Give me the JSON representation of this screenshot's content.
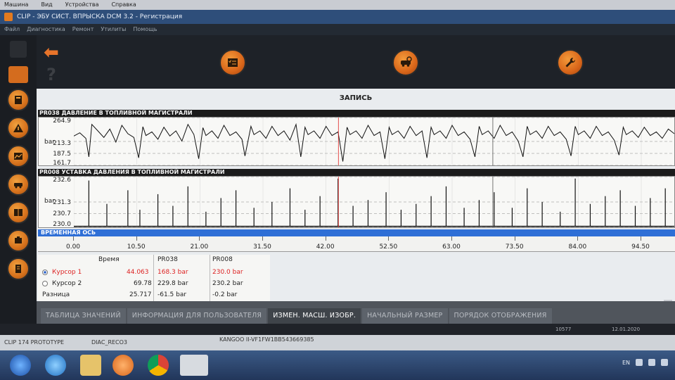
{
  "host_menu": [
    "Машина",
    "Вид",
    "Устройства",
    "Справка"
  ],
  "window_title": "CLIP - ЭБУ СИСТ. ВПРЫСКА DCM 3.2 - Регистрация",
  "app_menu": [
    "Файл",
    "Диагностика",
    "Ремонт",
    "Утилиты",
    "Помощь"
  ],
  "toolbar": {
    "icons": [
      "checklist-icon",
      "vehicle-diag-icon",
      "wrench-icon"
    ]
  },
  "left_rail": {
    "icons": [
      "home-icon",
      "printer-icon",
      "help-icon",
      "calculator-icon",
      "warning-icon",
      "chart-icon",
      "vehicle-icon",
      "book-icon",
      "engine-icon",
      "manual-icon"
    ]
  },
  "page": {
    "title": "ЗАПИСЬ"
  },
  "chart1": {
    "header": "PR038  ДАВЛЕНИЕ В ТОПЛИВНОЙ МАГИСТРАЛИ",
    "unit": "bar",
    "ticks": [
      "264.9",
      "213.3",
      "187.5",
      "161.7"
    ]
  },
  "chart2": {
    "header": "PR008  УСТАВКА ДАВЛЕНИЯ В ТОПЛИВНОЙ МАГИСТРАЛИ",
    "unit": "bar",
    "ticks": [
      "232.6",
      "231.3",
      "230.7",
      "230.0"
    ]
  },
  "time_axis": {
    "label": "ВРЕМЕННАЯ ОСЬ",
    "ticks": [
      "0.00",
      "10.50",
      "21.00",
      "31.50",
      "42.00",
      "52.50",
      "63.00",
      "73.50",
      "84.00",
      "94.50"
    ]
  },
  "cursor_table": {
    "headers": [
      "Время",
      "PR038",
      "PR008"
    ],
    "rows": [
      {
        "label": "Курсор 1",
        "time": "44.063",
        "pr038": "168.3 bar",
        "pr008": "230.0 bar"
      },
      {
        "label": "Курсор 2",
        "time": "69.78",
        "pr038": "229.8 bar",
        "pr008": "230.2 bar"
      },
      {
        "label": "Разница",
        "time": "25.717",
        "pr038": "-61.5 bar",
        "pr008": "-0.2 bar"
      }
    ]
  },
  "tabs": [
    "ТАБЛИЦА ЗНАЧЕНИЙ",
    "ИНФОРМАЦИЯ ДЛЯ ПОЛЬЗОВАТЕЛЯ",
    "ИЗМЕН. МАСШ. ИЗОБР.",
    "НАЧАЛЬНЫЙ РАЗМЕР",
    "ПОРЯДОК ОТОБРАЖЕНИЯ"
  ],
  "status": {
    "code": "10577",
    "date": "12.01.2020",
    "device": "CLIP 174 PROTOTYPE",
    "reco": "DIAC_RECO3",
    "vehicle": "KANGOO II-VF1FW1BB543669385"
  },
  "taskbar": {
    "apps": [
      "windows-start-icon",
      "ie-icon",
      "folder-icon",
      "media-player-icon",
      "chrome-icon",
      "clip-app-icon"
    ],
    "language": "EN"
  },
  "chart_data": [
    {
      "type": "line",
      "title": "PR038  ДАВЛЕНИЕ В ТОПЛИВНОЙ МАГИСТРАЛИ",
      "ylabel": "bar",
      "ylim": [
        161.7,
        264.9
      ],
      "y_ticks": [
        264.9,
        213.3,
        187.5,
        161.7
      ],
      "x_ticks": [
        0.0,
        10.5,
        21.0,
        31.5,
        42.0,
        52.5,
        63.0,
        73.5,
        84.0,
        94.5
      ],
      "xlim": [
        0,
        100
      ],
      "series": [
        {
          "x": [
            0,
            1,
            2,
            2.5,
            3,
            4,
            5,
            6,
            7,
            8,
            9,
            10,
            10.8,
            11.5,
            12,
            13,
            14,
            15,
            16,
            17,
            18,
            19,
            20,
            20.8,
            21.5,
            22,
            23,
            24,
            25,
            26,
            27,
            28,
            28.5,
            29.5,
            30,
            31,
            32,
            33,
            34,
            35,
            36,
            37,
            37.8,
            38.5,
            39,
            40,
            41,
            42,
            43,
            44,
            44.8,
            45.5,
            46,
            47,
            48,
            49,
            50,
            51,
            51.8,
            52.5,
            53,
            54,
            55,
            56,
            57,
            58,
            58.8,
            59.5,
            60,
            61,
            62,
            63,
            64,
            65,
            66,
            66.8,
            67.5,
            68,
            69,
            70,
            71,
            72,
            73,
            74,
            74.8,
            75.5,
            76,
            77,
            78,
            79,
            80,
            81,
            82,
            82.8,
            83.5,
            84,
            85,
            86,
            87,
            88,
            89,
            90,
            90.8,
            91.5,
            92,
            93,
            94,
            95,
            96,
            97,
            98,
            99,
            100
          ],
          "y": [
            225,
            232,
            220,
            180,
            250,
            236,
            222,
            240,
            212,
            248,
            230,
            222,
            178,
            245,
            226,
            234,
            218,
            244,
            225,
            236,
            214,
            250,
            228,
            176,
            243,
            226,
            236,
            220,
            248,
            226,
            234,
            218,
            182,
            246,
            228,
            236,
            220,
            246,
            226,
            236,
            216,
            250,
            180,
            244,
            228,
            236,
            220,
            246,
            226,
            234,
            170,
            244,
            228,
            236,
            220,
            248,
            226,
            234,
            176,
            244,
            228,
            236,
            220,
            246,
            226,
            236,
            178,
            244,
            228,
            236,
            220,
            248,
            226,
            234,
            218,
            180,
            246,
            228,
            236,
            220,
            248,
            226,
            234,
            214,
            180,
            246,
            228,
            236,
            220,
            246,
            226,
            234,
            218,
            182,
            246,
            228,
            236,
            220,
            246,
            226,
            234,
            216,
            184,
            244,
            228,
            236,
            222,
            244,
            226,
            234,
            220,
            240,
            230
          ]
        }
      ]
    },
    {
      "type": "line",
      "title": "PR008  УСТАВКА ДАВЛЕНИЯ В ТОПЛИВНОЙ МАГИСТРАЛИ",
      "ylabel": "bar",
      "ylim": [
        230.0,
        232.6
      ],
      "y_ticks": [
        232.6,
        231.3,
        230.7,
        230.0
      ],
      "x_ticks": [
        0.0,
        10.5,
        21.0,
        31.5,
        42.0,
        52.5,
        63.0,
        73.5,
        84.0,
        94.5
      ],
      "xlim": [
        0,
        100
      ],
      "series": [
        {
          "spikes_x": [
            2.5,
            5.5,
            9,
            11,
            14,
            16.5,
            19,
            22,
            24.5,
            27,
            30,
            33,
            36,
            38.5,
            41,
            44,
            46.5,
            49,
            52,
            54.5,
            57,
            59.5,
            62,
            65,
            67.5,
            70,
            73,
            75.5,
            78,
            81,
            83.5,
            86,
            88.5,
            91,
            93.5,
            96,
            98.5
          ],
          "spikes_y": [
            232.4,
            231.2,
            231.9,
            230.9,
            231.7,
            231.1,
            232.1,
            230.8,
            231.5,
            231.9,
            231.0,
            231.3,
            232.0,
            230.9,
            231.6,
            232.5,
            231.1,
            231.4,
            231.8,
            230.9,
            231.2,
            231.6,
            232.1,
            231.0,
            231.4,
            231.8,
            231.0,
            232.0,
            231.3,
            230.8,
            232.5,
            231.2,
            231.6,
            231.9,
            231.1,
            231.5,
            232.0
          ]
        }
      ]
    }
  ],
  "colors": {
    "accent": "#e27a1f",
    "chart_bg": "#f8f8f6",
    "time_axis": "#2f6fd6",
    "cursor_line": "#d22",
    "cursor_line2": "#555"
  }
}
